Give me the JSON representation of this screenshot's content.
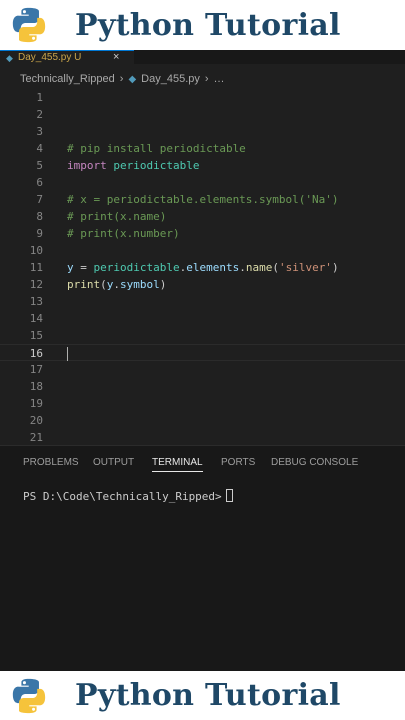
{
  "banner": {
    "title": "Python Tutorial"
  },
  "tab": {
    "filename": "Day_455.py U",
    "close": "×"
  },
  "breadcrumb": {
    "folder": "Technically_Ripped",
    "file": "Day_455.py",
    "more": "…"
  },
  "editor": {
    "line_numbers": [
      "1",
      "2",
      "3",
      "4",
      "5",
      "6",
      "7",
      "8",
      "9",
      "10",
      "11",
      "12",
      "13",
      "14",
      "15",
      "16",
      "17",
      "18",
      "19",
      "20",
      "21"
    ],
    "code": {
      "l4_comment": "# pip install periodictable",
      "l5_import": "import",
      "l5_module": "periodictable",
      "l7_comment": "# x = periodictable.elements.symbol('Na')",
      "l8_comment": "# print(x.name)",
      "l9_comment": "# print(x.number)",
      "l11_var": "y",
      "l11_eq": " = ",
      "l11_module": "periodictable",
      "l11_dot1": ".",
      "l11_attr": "elements",
      "l11_dot2": ".",
      "l11_func": "name",
      "l11_open": "(",
      "l11_string": "'silver'",
      "l11_close": ")",
      "l12_func": "print",
      "l12_open": "(",
      "l12_var": "y",
      "l12_dot": ".",
      "l12_attr": "symbol",
      "l12_close": ")"
    }
  },
  "panel": {
    "tabs": [
      "PROBLEMS",
      "OUTPUT",
      "TERMINAL",
      "PORTS",
      "DEBUG CONSOLE"
    ],
    "active_tab": "TERMINAL",
    "prompt": "PS D:\\Code\\Technically_Ripped>"
  },
  "colors": {
    "editor_bg": "#1f1f1f",
    "comment": "#6a9955",
    "keyword": "#c586c0",
    "module": "#4ec9b0",
    "variable": "#9cdcfe",
    "function": "#dcdcaa",
    "string": "#ce9178",
    "banner_text": "#1f4867"
  },
  "icons": [
    "python-logo-icon",
    "python-file-icon",
    "chevron-right-icon",
    "close-icon"
  ]
}
